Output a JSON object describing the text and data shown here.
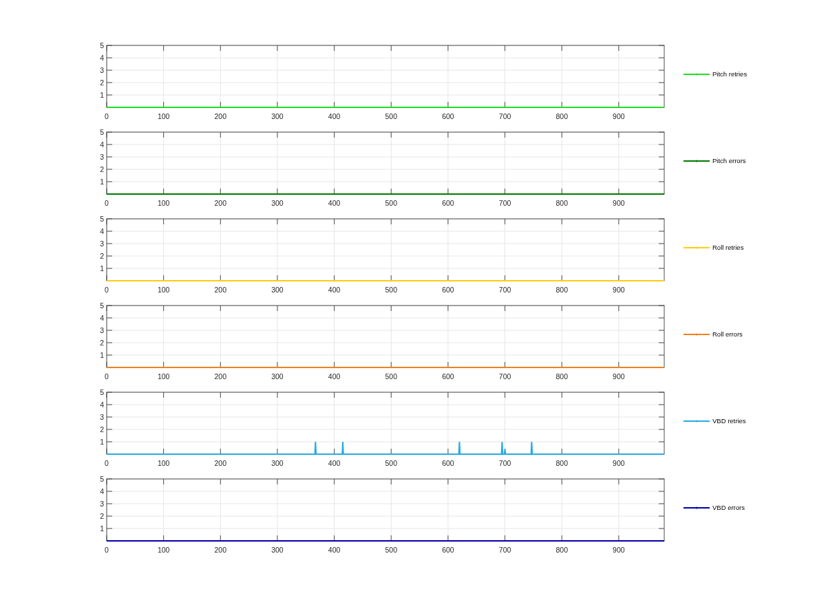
{
  "charts": [
    {
      "chart_data": {
        "type": "line",
        "x": [
          0,
          980
        ],
        "series": [
          {
            "name": "Pitch retries",
            "color": "#22dd22",
            "values": [
              0,
              0
            ]
          }
        ],
        "grid": true,
        "xlim": [
          0,
          980
        ],
        "ylim": [
          0,
          5
        ],
        "xticks": [
          0,
          100,
          200,
          300,
          400,
          500,
          600,
          700,
          800,
          900
        ],
        "yticks": [
          1,
          2,
          3,
          4,
          5
        ]
      }
    },
    {
      "chart_data": {
        "type": "line",
        "x": [
          0,
          980
        ],
        "series": [
          {
            "name": "Pitch errors",
            "color": "#007a00",
            "values": [
              0,
              0
            ]
          }
        ],
        "grid": true,
        "xlim": [
          0,
          980
        ],
        "ylim": [
          0,
          5
        ],
        "xticks": [
          0,
          100,
          200,
          300,
          400,
          500,
          600,
          700,
          800,
          900
        ],
        "yticks": [
          1,
          2,
          3,
          4,
          5
        ]
      }
    },
    {
      "chart_data": {
        "type": "line",
        "x": [
          0,
          980
        ],
        "series": [
          {
            "name": "Roll retries",
            "color": "#ffcc11",
            "values": [
              0,
              0
            ]
          }
        ],
        "grid": true,
        "xlim": [
          0,
          980
        ],
        "ylim": [
          0,
          5
        ],
        "xticks": [
          0,
          100,
          200,
          300,
          400,
          500,
          600,
          700,
          800,
          900
        ],
        "yticks": [
          1,
          2,
          3,
          4,
          5
        ]
      }
    },
    {
      "chart_data": {
        "type": "line",
        "x": [
          0,
          980
        ],
        "series": [
          {
            "name": "Roll errors",
            "color": "#f08020",
            "values": [
              0,
              0
            ]
          }
        ],
        "grid": true,
        "xlim": [
          0,
          980
        ],
        "ylim": [
          0,
          5
        ],
        "xticks": [
          0,
          100,
          200,
          300,
          400,
          500,
          600,
          700,
          800,
          900
        ],
        "yticks": [
          1,
          2,
          3,
          4,
          5
        ]
      }
    },
    {
      "chart_data": {
        "type": "line",
        "x": [
          0,
          366,
          367,
          368,
          414,
          415,
          416,
          619,
          620,
          621,
          694,
          695,
          696,
          699,
          700,
          701,
          746,
          747,
          748,
          980
        ],
        "series": [
          {
            "name": "VBD retries",
            "color": "#29abe2",
            "values": [
              0,
              0,
              1,
              0,
              0,
              1,
              0,
              0,
              1,
              0,
              0,
              1,
              0,
              0,
              0.4,
              0,
              0,
              1,
              0,
              0
            ]
          }
        ],
        "grid": true,
        "xlim": [
          0,
          980
        ],
        "ylim": [
          0,
          5
        ],
        "xticks": [
          0,
          100,
          200,
          300,
          400,
          500,
          600,
          700,
          800,
          900
        ],
        "yticks": [
          1,
          2,
          3,
          4,
          5
        ]
      }
    },
    {
      "chart_data": {
        "type": "line",
        "x": [
          0,
          980
        ],
        "series": [
          {
            "name": "VBD errors",
            "color": "#0000aa",
            "values": [
              0,
              0
            ]
          }
        ],
        "grid": true,
        "xlim": [
          0,
          980
        ],
        "ylim": [
          0,
          5
        ],
        "xticks": [
          0,
          100,
          200,
          300,
          400,
          500,
          600,
          700,
          800,
          900
        ],
        "yticks": [
          1,
          2,
          3,
          4,
          5
        ]
      }
    }
  ]
}
